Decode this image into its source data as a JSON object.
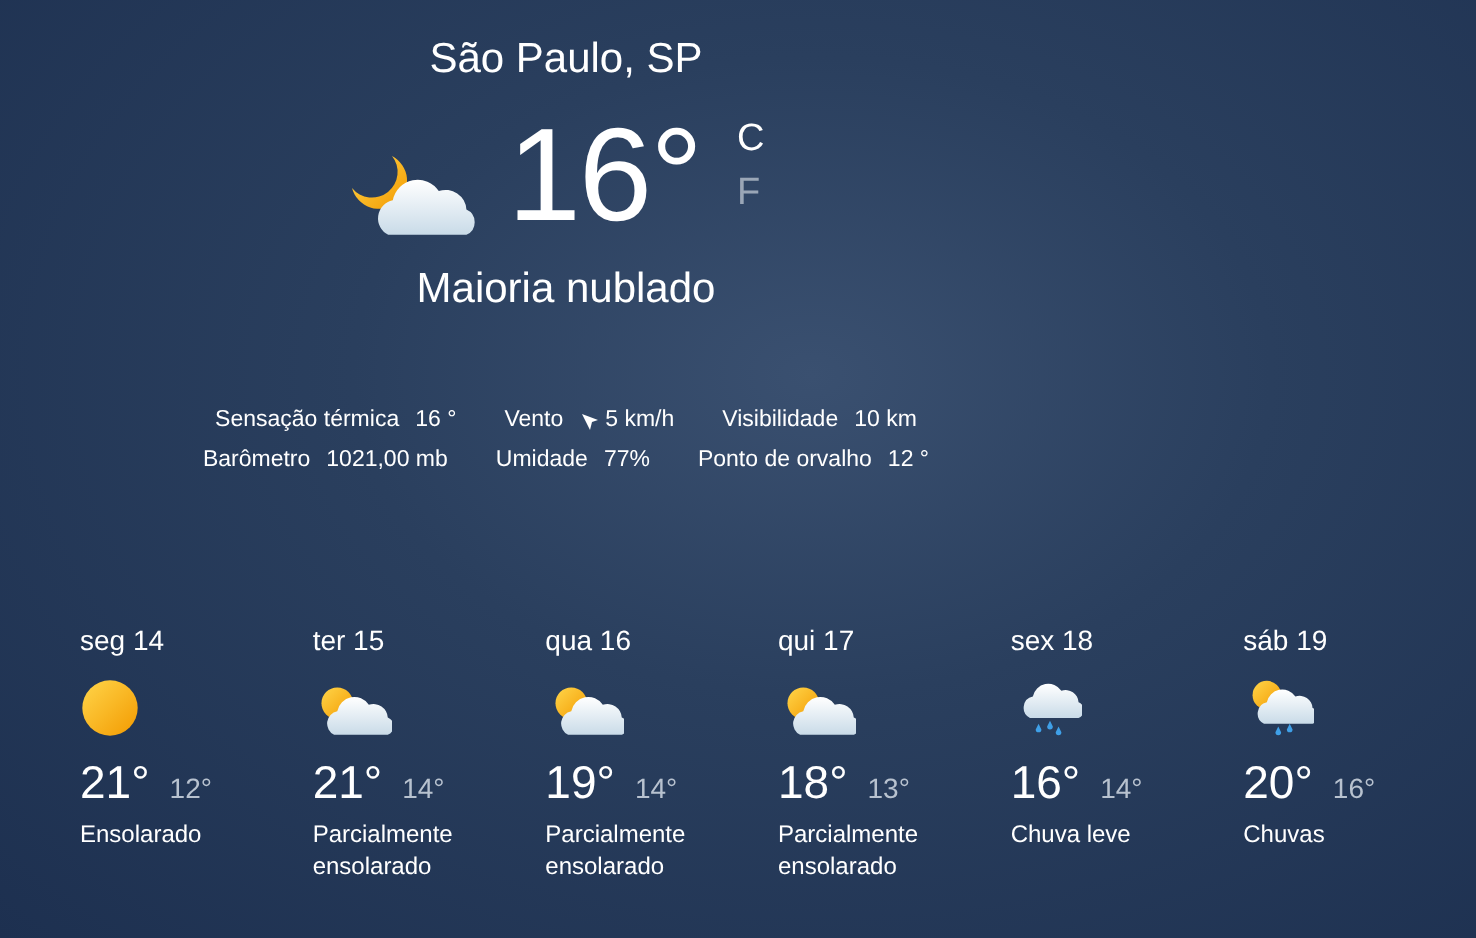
{
  "location": "São Paulo, SP",
  "current": {
    "kind": "moon-cloud",
    "temperature": "16°",
    "units": [
      {
        "label": "C",
        "selected": true
      },
      {
        "label": "F",
        "selected": false
      }
    ],
    "condition": "Maioria nublado"
  },
  "details": [
    [
      {
        "kind": "plain",
        "label": "Sensação térmica",
        "value": "16 °"
      },
      {
        "kind": "wind",
        "label": "Vento",
        "value": "5 km/h"
      },
      {
        "kind": "plain",
        "label": "Visibilidade",
        "value": "10 km"
      }
    ],
    [
      {
        "kind": "plain",
        "label": "Barômetro",
        "value": "1021,00 mb"
      },
      {
        "kind": "plain",
        "label": "Umidade",
        "value": "77%"
      },
      {
        "kind": "plain",
        "label": "Ponto de orvalho",
        "value": "12 °"
      }
    ]
  ],
  "forecast": [
    {
      "day": "seg 14",
      "kind": "sun",
      "high": "21°",
      "low": "12°",
      "condition": "Ensolarado"
    },
    {
      "day": "ter 15",
      "kind": "partly-cloudy",
      "high": "21°",
      "low": "14°",
      "condition": "Parcialmente ensolarado"
    },
    {
      "day": "qua 16",
      "kind": "partly-cloudy",
      "high": "19°",
      "low": "14°",
      "condition": "Parcialmente ensolarado"
    },
    {
      "day": "qui 17",
      "kind": "partly-cloudy",
      "high": "18°",
      "low": "13°",
      "condition": "Parcialmente ensolarado"
    },
    {
      "day": "sex 18",
      "kind": "rain-cloud",
      "high": "16°",
      "low": "14°",
      "condition": "Chuva leve"
    },
    {
      "day": "sáb 19",
      "kind": "sun-rain",
      "high": "20°",
      "low": "16°",
      "condition": "Chuvas"
    }
  ]
}
